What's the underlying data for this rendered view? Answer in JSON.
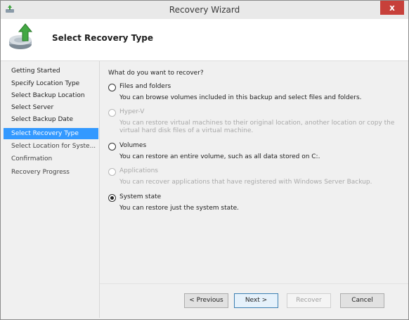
{
  "window": {
    "title": "Recovery Wizard",
    "close_glyph": "x"
  },
  "header": {
    "title": "Select Recovery Type",
    "icon": "backup-restore-icon"
  },
  "sidebar": {
    "items": [
      {
        "label": "Getting Started"
      },
      {
        "label": "Specify Location Type"
      },
      {
        "label": "Select Backup Location"
      },
      {
        "label": "Select Server"
      },
      {
        "label": "Select Backup Date"
      },
      {
        "label": "Select Recovery Type"
      },
      {
        "label": "Select Location for Syste..."
      },
      {
        "label": "Confirmation"
      },
      {
        "label": "Recovery Progress"
      }
    ],
    "active_index": 5
  },
  "main": {
    "question": "What do you want to recover?",
    "options": [
      {
        "label": "Files and folders",
        "description": "You can browse volumes included in this backup and select files and folders.",
        "enabled": true,
        "checked": false
      },
      {
        "label": "Hyper-V",
        "description": "You can restore virtual machines to their original location, another location or copy the virtual hard disk files of a virtual machine.",
        "enabled": false,
        "checked": false
      },
      {
        "label": "Volumes",
        "description": "You can restore an entire volume, such as all data stored on C:.",
        "enabled": true,
        "checked": false
      },
      {
        "label": "Applications",
        "description": "You can recover applications that have registered with Windows Server Backup.",
        "enabled": false,
        "checked": false
      },
      {
        "label": "System state",
        "description": "You can restore just the system state.",
        "enabled": true,
        "checked": true
      }
    ]
  },
  "footer": {
    "previous_label": "< Previous",
    "next_label": "Next >",
    "recover_label": "Recover",
    "cancel_label": "Cancel"
  },
  "colors": {
    "selection": "#3399ff",
    "close_button": "#c7403a",
    "disabled_text": "#a8a8a8"
  }
}
